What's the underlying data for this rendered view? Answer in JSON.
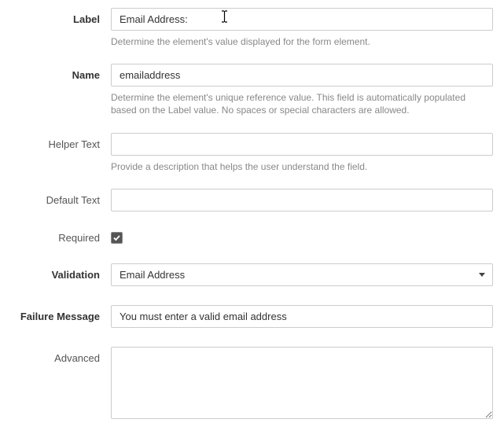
{
  "labels": {
    "label": "Label",
    "name": "Name",
    "helper_text": "Helper Text",
    "default_text": "Default Text",
    "required": "Required",
    "validation": "Validation",
    "failure_message": "Failure Message",
    "advanced": "Advanced"
  },
  "values": {
    "label": "Email Address:",
    "name": "emailaddress",
    "helper_text": "",
    "default_text": "",
    "required": true,
    "validation": "Email Address",
    "failure_message": "You must enter a valid email address",
    "advanced": ""
  },
  "help": {
    "label": "Determine the element's value displayed for the form element.",
    "name": "Determine the element's unique reference value. This field is automatically populated based on the Label value. No spaces or special characters are allowed.",
    "helper_text": "Provide a description that helps the user understand the field."
  }
}
